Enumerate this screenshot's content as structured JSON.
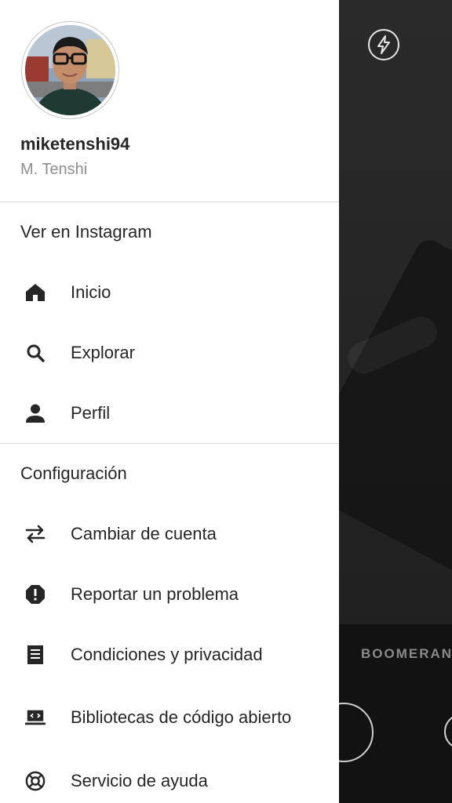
{
  "profile": {
    "username": "miketenshi94",
    "full_name": "M. Tenshi"
  },
  "sections": {
    "view_on_instagram": "Ver en Instagram",
    "settings": "Configuración"
  },
  "nav": {
    "home": "Inicio",
    "explore": "Explorar",
    "profile": "Perfil"
  },
  "settings_items": {
    "switch_account": "Cambiar de cuenta",
    "report_problem": "Reportar un problema",
    "terms_privacy": "Condiciones y privacidad",
    "open_source": "Bibliotecas de código abierto",
    "help_center": "Servicio de ayuda"
  },
  "camera": {
    "mode_label": "BOOMERANG"
  },
  "icons": {
    "flash": "flash-icon",
    "home": "home-icon",
    "search": "search-icon",
    "person": "person-icon",
    "swap": "swap-arrows-icon",
    "report": "alert-octagon-icon",
    "document": "document-icon",
    "code": "code-laptop-icon",
    "help": "lifebuoy-icon"
  },
  "colors": {
    "text_primary": "#262626",
    "text_secondary": "#8e8e8e",
    "divider": "#dbdbdb",
    "drawer_bg": "#ffffff"
  }
}
